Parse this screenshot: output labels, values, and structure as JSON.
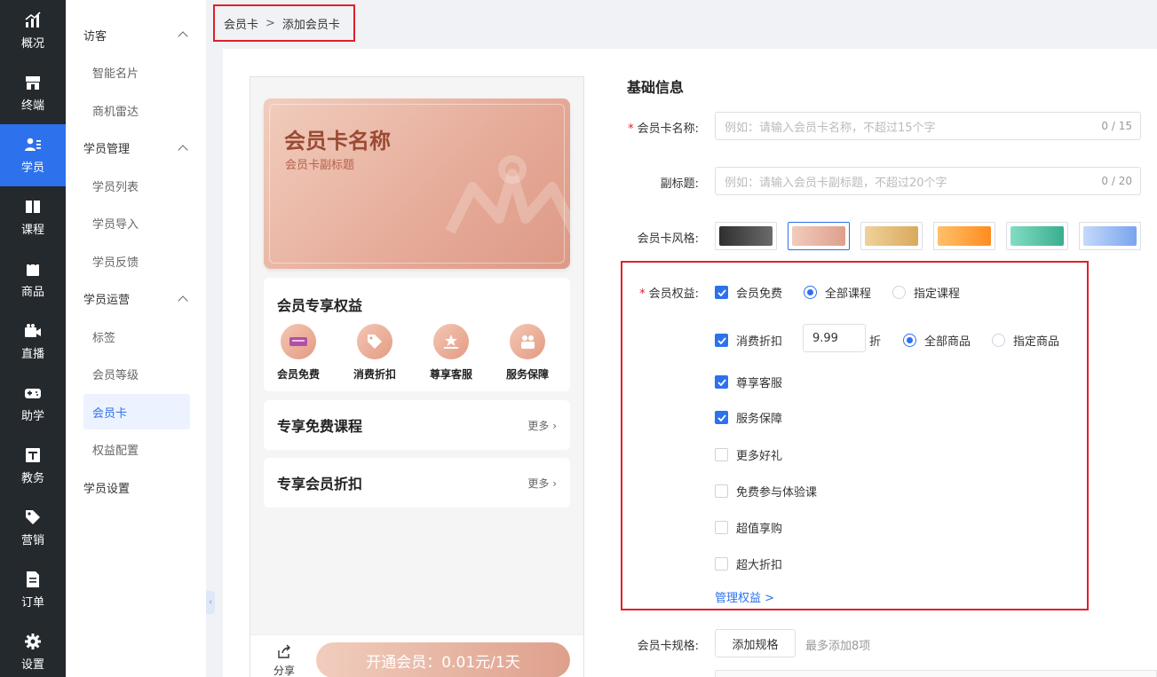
{
  "nav": [
    {
      "label": "概况",
      "icon": "chart-icon"
    },
    {
      "label": "终端",
      "icon": "store-icon"
    },
    {
      "label": "学员",
      "icon": "users-icon",
      "active": true
    },
    {
      "label": "课程",
      "icon": "book-icon"
    },
    {
      "label": "商品",
      "icon": "bag-icon"
    },
    {
      "label": "直播",
      "icon": "video-icon"
    },
    {
      "label": "助学",
      "icon": "gamepad-icon"
    },
    {
      "label": "教务",
      "icon": "board-icon"
    },
    {
      "label": "营销",
      "icon": "tag-icon"
    },
    {
      "label": "订单",
      "icon": "document-icon"
    },
    {
      "label": "设置",
      "icon": "gear-icon"
    }
  ],
  "menu": {
    "visitor": {
      "title": "访客",
      "items": [
        "智能名片",
        "商机雷达"
      ]
    },
    "student_mgmt": {
      "title": "学员管理",
      "items": [
        "学员列表",
        "学员导入",
        "学员反馈"
      ]
    },
    "student_ops": {
      "title": "学员运营",
      "items": [
        "标签",
        "会员等级",
        "会员卡",
        "权益配置"
      ]
    },
    "settings": "学员设置",
    "active_item": "会员卡"
  },
  "breadcrumb": {
    "parent": "会员卡",
    "separator": ">",
    "current": "添加会员卡"
  },
  "preview": {
    "card_title": "会员卡名称",
    "card_subtitle": "会员卡副标题",
    "benefits_title": "会员专享权益",
    "benefits": [
      {
        "label": "会员免费",
        "icon": "keyboard-icon"
      },
      {
        "label": "消费折扣",
        "icon": "discount-tag-icon"
      },
      {
        "label": "尊享客服",
        "icon": "service-icon"
      },
      {
        "label": "服务保障",
        "icon": "guarantee-icon"
      }
    ],
    "free_courses_title": "专享免费课程",
    "member_discount_title": "专享会员折扣",
    "more_label": "更多",
    "share_label": "分享",
    "open_button": "开通会员：0.01元/1天"
  },
  "form": {
    "section_title": "基础信息",
    "name_label": "会员卡名称:",
    "name_placeholder": "例如：请输入会员卡名称，不超过15个字",
    "name_count": "0 / 15",
    "subtitle_label": "副标题:",
    "subtitle_placeholder": "例如：请输入会员卡副标题，不超过20个字",
    "subtitle_count": "0 / 20",
    "style_label": "会员卡风格:",
    "style_colors": [
      [
        "#2f2f2f",
        "#6b6b6b"
      ],
      [
        "#f2cbbd",
        "#dea08c"
      ],
      [
        "#efd29a",
        "#d9a95c"
      ],
      [
        "#ffc06a",
        "#ff8c1f"
      ],
      [
        "#83dcc4",
        "#3aae8f"
      ],
      [
        "#c4d9fb",
        "#7aa4ee"
      ]
    ],
    "selected_style": 1,
    "rights_label": "会员权益:",
    "rights": {
      "free": {
        "label": "会员免费",
        "checked": true
      },
      "all_courses": "全部课程",
      "specific_courses": "指定课程",
      "discount": {
        "label": "消费折扣",
        "checked": true
      },
      "discount_value": "9.99",
      "discount_unit": "折",
      "all_goods": "全部商品",
      "specific_goods": "指定商品",
      "service": {
        "label": "尊享客服",
        "checked": true
      },
      "guarantee": {
        "label": "服务保障",
        "checked": true
      },
      "gifts": {
        "label": "更多好礼",
        "checked": false
      },
      "trial": {
        "label": "免费参与体验课",
        "checked": false
      },
      "value_buy": {
        "label": "超值享购",
        "checked": false
      },
      "big_discount": {
        "label": "超大折扣",
        "checked": false
      }
    },
    "manage_rights": "管理权益 >",
    "spec_label": "会员卡规格:",
    "add_spec": "添加规格",
    "spec_tip": "最多添加8项"
  }
}
